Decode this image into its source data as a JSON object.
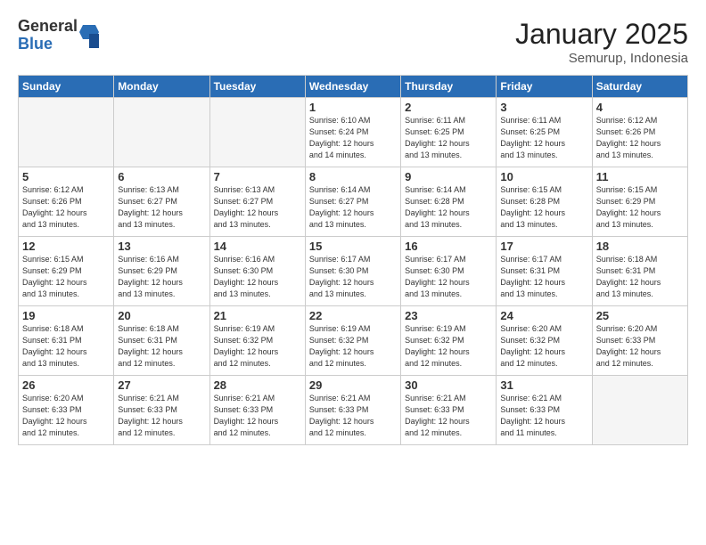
{
  "header": {
    "logo_general": "General",
    "logo_blue": "Blue",
    "month_title": "January 2025",
    "subtitle": "Semurup, Indonesia"
  },
  "weekdays": [
    "Sunday",
    "Monday",
    "Tuesday",
    "Wednesday",
    "Thursday",
    "Friday",
    "Saturday"
  ],
  "weeks": [
    [
      {
        "day": "",
        "info": ""
      },
      {
        "day": "",
        "info": ""
      },
      {
        "day": "",
        "info": ""
      },
      {
        "day": "1",
        "info": "Sunrise: 6:10 AM\nSunset: 6:24 PM\nDaylight: 12 hours\nand 14 minutes."
      },
      {
        "day": "2",
        "info": "Sunrise: 6:11 AM\nSunset: 6:25 PM\nDaylight: 12 hours\nand 13 minutes."
      },
      {
        "day": "3",
        "info": "Sunrise: 6:11 AM\nSunset: 6:25 PM\nDaylight: 12 hours\nand 13 minutes."
      },
      {
        "day": "4",
        "info": "Sunrise: 6:12 AM\nSunset: 6:26 PM\nDaylight: 12 hours\nand 13 minutes."
      }
    ],
    [
      {
        "day": "5",
        "info": "Sunrise: 6:12 AM\nSunset: 6:26 PM\nDaylight: 12 hours\nand 13 minutes."
      },
      {
        "day": "6",
        "info": "Sunrise: 6:13 AM\nSunset: 6:27 PM\nDaylight: 12 hours\nand 13 minutes."
      },
      {
        "day": "7",
        "info": "Sunrise: 6:13 AM\nSunset: 6:27 PM\nDaylight: 12 hours\nand 13 minutes."
      },
      {
        "day": "8",
        "info": "Sunrise: 6:14 AM\nSunset: 6:27 PM\nDaylight: 12 hours\nand 13 minutes."
      },
      {
        "day": "9",
        "info": "Sunrise: 6:14 AM\nSunset: 6:28 PM\nDaylight: 12 hours\nand 13 minutes."
      },
      {
        "day": "10",
        "info": "Sunrise: 6:15 AM\nSunset: 6:28 PM\nDaylight: 12 hours\nand 13 minutes."
      },
      {
        "day": "11",
        "info": "Sunrise: 6:15 AM\nSunset: 6:29 PM\nDaylight: 12 hours\nand 13 minutes."
      }
    ],
    [
      {
        "day": "12",
        "info": "Sunrise: 6:15 AM\nSunset: 6:29 PM\nDaylight: 12 hours\nand 13 minutes."
      },
      {
        "day": "13",
        "info": "Sunrise: 6:16 AM\nSunset: 6:29 PM\nDaylight: 12 hours\nand 13 minutes."
      },
      {
        "day": "14",
        "info": "Sunrise: 6:16 AM\nSunset: 6:30 PM\nDaylight: 12 hours\nand 13 minutes."
      },
      {
        "day": "15",
        "info": "Sunrise: 6:17 AM\nSunset: 6:30 PM\nDaylight: 12 hours\nand 13 minutes."
      },
      {
        "day": "16",
        "info": "Sunrise: 6:17 AM\nSunset: 6:30 PM\nDaylight: 12 hours\nand 13 minutes."
      },
      {
        "day": "17",
        "info": "Sunrise: 6:17 AM\nSunset: 6:31 PM\nDaylight: 12 hours\nand 13 minutes."
      },
      {
        "day": "18",
        "info": "Sunrise: 6:18 AM\nSunset: 6:31 PM\nDaylight: 12 hours\nand 13 minutes."
      }
    ],
    [
      {
        "day": "19",
        "info": "Sunrise: 6:18 AM\nSunset: 6:31 PM\nDaylight: 12 hours\nand 13 minutes."
      },
      {
        "day": "20",
        "info": "Sunrise: 6:18 AM\nSunset: 6:31 PM\nDaylight: 12 hours\nand 12 minutes."
      },
      {
        "day": "21",
        "info": "Sunrise: 6:19 AM\nSunset: 6:32 PM\nDaylight: 12 hours\nand 12 minutes."
      },
      {
        "day": "22",
        "info": "Sunrise: 6:19 AM\nSunset: 6:32 PM\nDaylight: 12 hours\nand 12 minutes."
      },
      {
        "day": "23",
        "info": "Sunrise: 6:19 AM\nSunset: 6:32 PM\nDaylight: 12 hours\nand 12 minutes."
      },
      {
        "day": "24",
        "info": "Sunrise: 6:20 AM\nSunset: 6:32 PM\nDaylight: 12 hours\nand 12 minutes."
      },
      {
        "day": "25",
        "info": "Sunrise: 6:20 AM\nSunset: 6:33 PM\nDaylight: 12 hours\nand 12 minutes."
      }
    ],
    [
      {
        "day": "26",
        "info": "Sunrise: 6:20 AM\nSunset: 6:33 PM\nDaylight: 12 hours\nand 12 minutes."
      },
      {
        "day": "27",
        "info": "Sunrise: 6:21 AM\nSunset: 6:33 PM\nDaylight: 12 hours\nand 12 minutes."
      },
      {
        "day": "28",
        "info": "Sunrise: 6:21 AM\nSunset: 6:33 PM\nDaylight: 12 hours\nand 12 minutes."
      },
      {
        "day": "29",
        "info": "Sunrise: 6:21 AM\nSunset: 6:33 PM\nDaylight: 12 hours\nand 12 minutes."
      },
      {
        "day": "30",
        "info": "Sunrise: 6:21 AM\nSunset: 6:33 PM\nDaylight: 12 hours\nand 12 minutes."
      },
      {
        "day": "31",
        "info": "Sunrise: 6:21 AM\nSunset: 6:33 PM\nDaylight: 12 hours\nand 11 minutes."
      },
      {
        "day": "",
        "info": ""
      }
    ]
  ]
}
